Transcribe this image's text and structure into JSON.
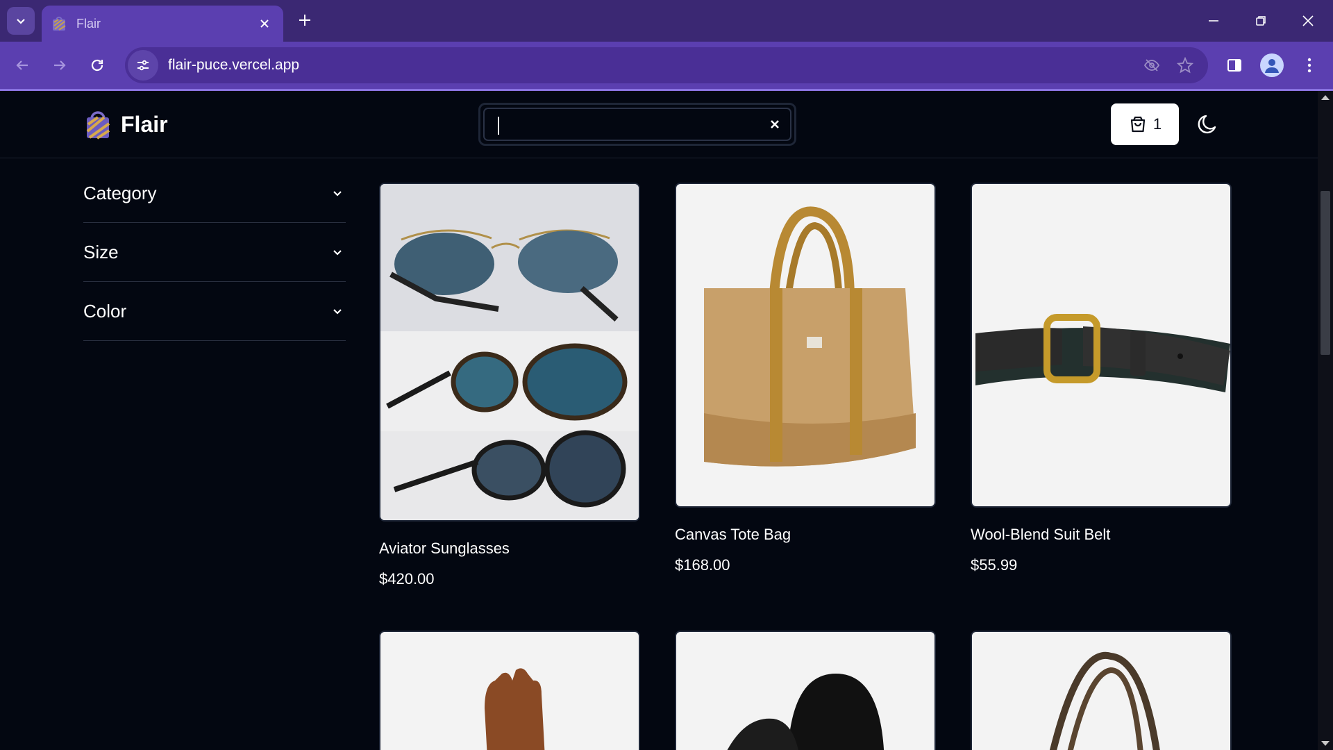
{
  "browser": {
    "tab_title": "Flair",
    "url": "flair-puce.vercel.app"
  },
  "site": {
    "brand": "Flair",
    "search": {
      "value": "",
      "placeholder": ""
    },
    "cart_count": "1"
  },
  "filters": [
    {
      "label": "Category"
    },
    {
      "label": "Size"
    },
    {
      "label": "Color"
    }
  ],
  "products": [
    {
      "name": "Aviator Sunglasses",
      "price": "$420.00"
    },
    {
      "name": "Canvas Tote Bag",
      "price": "$168.00"
    },
    {
      "name": "Wool-Blend Suit Belt",
      "price": "$55.99"
    }
  ],
  "colors": {
    "chrome_dark": "#3b2873",
    "chrome_toolbar": "#5b3fb0",
    "page_bg": "#030711"
  },
  "icons": [
    "tab-search-icon",
    "close-icon",
    "plus-icon",
    "minimize-icon",
    "restore-icon",
    "back-icon",
    "forward-icon",
    "reload-icon",
    "site-settings-icon",
    "eye-off-icon",
    "star-icon",
    "sidebar-icon",
    "profile-icon",
    "menu-icon",
    "shopping-bag-icon",
    "moon-icon",
    "chevron-down-icon"
  ]
}
